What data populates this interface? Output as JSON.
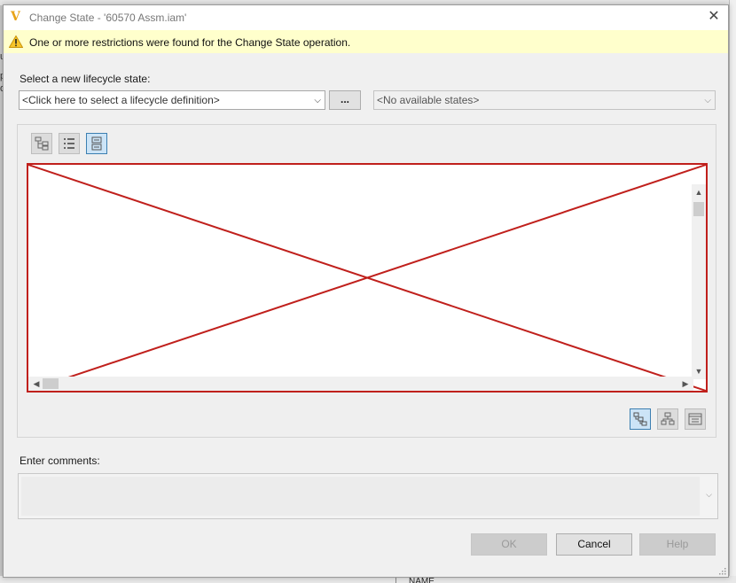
{
  "background": {
    "left_text": [
      "u",
      "p",
      "oj"
    ],
    "bottom_column_label": "NAME"
  },
  "dialog": {
    "title": "Change State - '60570 Assm.iam'",
    "app_icon_letter": "V",
    "close_glyph": "✕"
  },
  "warning": {
    "text": "One or more restrictions were found for the Change State operation."
  },
  "state_section": {
    "label": "Select a new lifecycle state:",
    "definition_value": "<Click here to select a lifecycle definition>",
    "browse_label": "...",
    "states_value": "<No available states>"
  },
  "view_modes": [
    "tree-view",
    "list-view",
    "detail-view"
  ],
  "active_view_mode": "detail-view",
  "layout_modes": [
    "layout-horizontal",
    "layout-vertical",
    "layout-properties"
  ],
  "active_layout_mode": "layout-horizontal",
  "comments": {
    "label": "Enter comments:",
    "value": ""
  },
  "buttons": {
    "ok": "OK",
    "cancel": "Cancel",
    "help": "Help"
  },
  "colors": {
    "warning_background": "#ffffcc",
    "error_cross": "#c0201c",
    "app_icon": "#e8a317",
    "active_toggle_border": "#3c7fb1"
  }
}
